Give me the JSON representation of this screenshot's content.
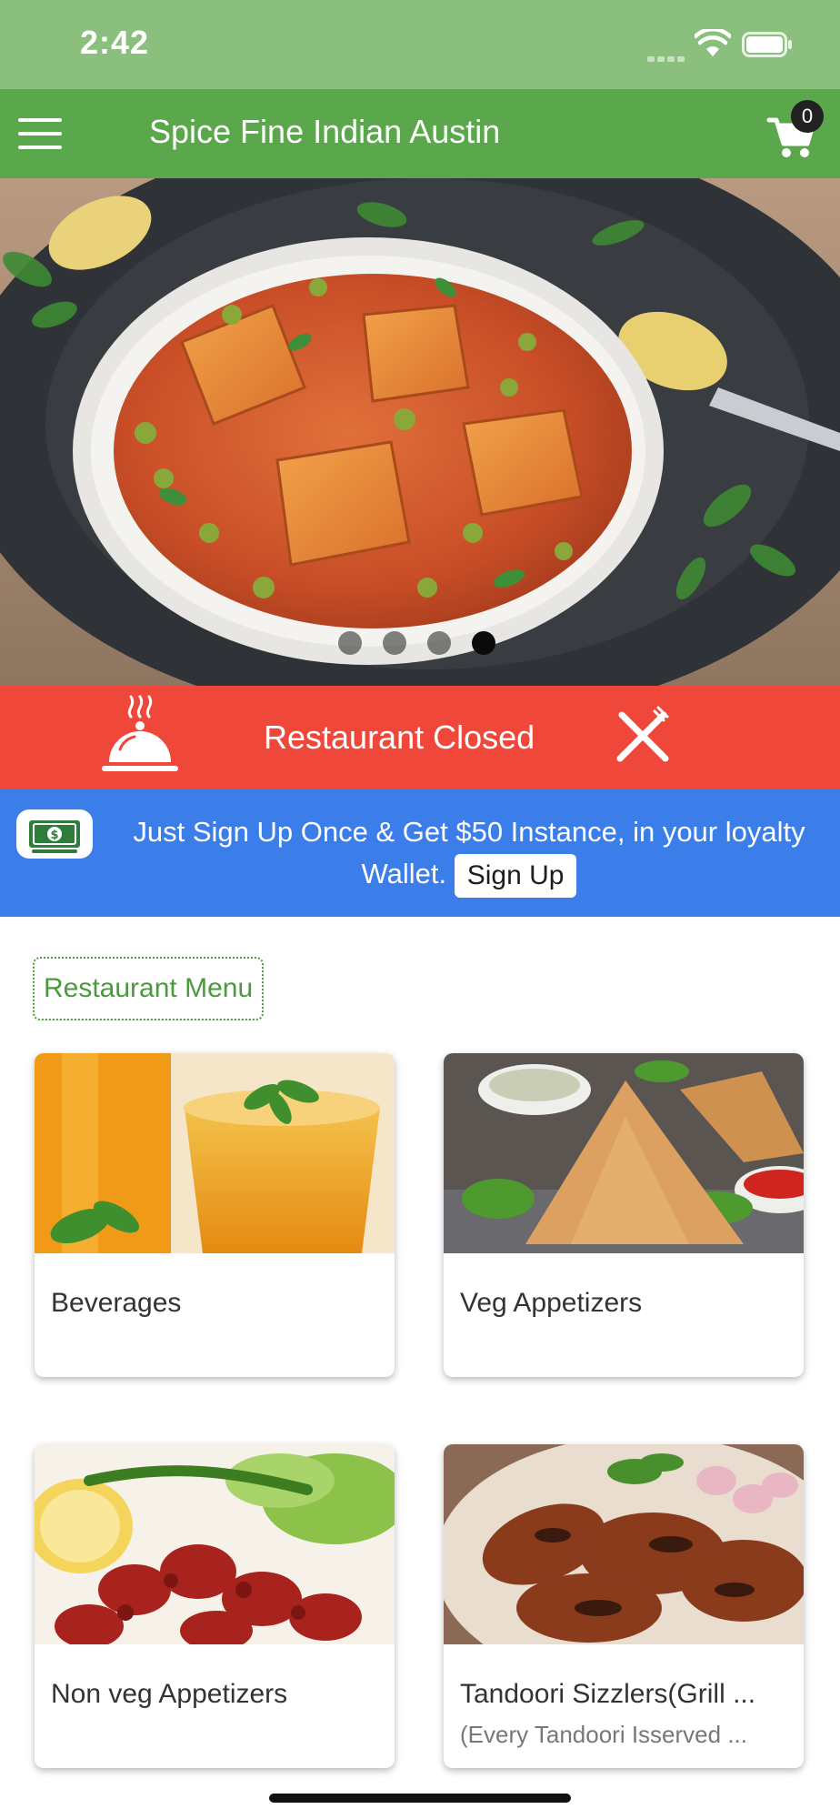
{
  "status_bar": {
    "time": "2:42"
  },
  "app_bar": {
    "title": "Spice Fine Indian Austin",
    "cart_count": "0"
  },
  "hero": {
    "pages": 4,
    "active_page": 4
  },
  "closed_banner": {
    "text": "Restaurant Closed"
  },
  "promo": {
    "text": "Just Sign Up Once & Get $50 Instance, in your loyalty Wallet.",
    "button_label": "Sign Up"
  },
  "menu": {
    "header": "Restaurant Menu",
    "categories": [
      {
        "title": "Beverages",
        "subtitle": ""
      },
      {
        "title": "Veg Appetizers",
        "subtitle": ""
      },
      {
        "title": "Non veg Appetizers",
        "subtitle": ""
      },
      {
        "title": "Tandoori Sizzlers(Grill ...",
        "subtitle": "(Every Tandoori Isserved ..."
      }
    ]
  },
  "colors": {
    "status_bar": "#8bbf7d",
    "app_bar": "#5aa84b",
    "closed_banner": "#ef473a",
    "promo_banner": "#3b7ee9",
    "menu_accent": "#4b9a3d"
  },
  "icons": {
    "menu": "hamburger-icon",
    "cart": "cart-icon",
    "closed_left": "cloche-icon",
    "closed_right": "cutlery-icon",
    "promo": "cash-icon"
  }
}
